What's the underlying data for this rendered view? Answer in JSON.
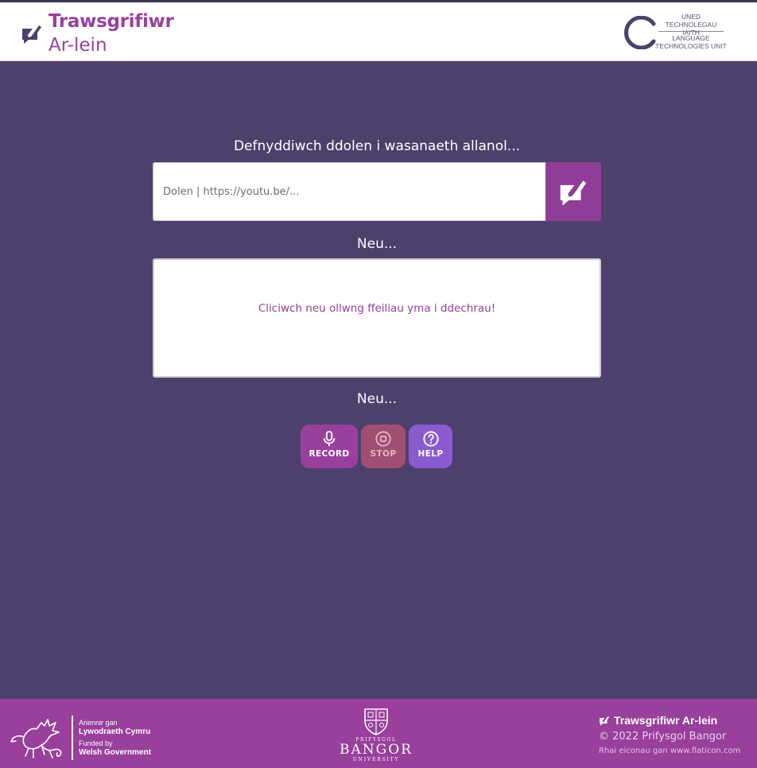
{
  "app": {
    "title": "Trawsgrifiwr",
    "subtitle": "Ar-lein"
  },
  "partner_logo": {
    "name": "ltu-logo",
    "line1": "UNED TECHNOLEGAU",
    "line2": "IAITH",
    "line3": "LANGUAGE",
    "line4": "TECHNOLOGIES UNIT"
  },
  "link_section": {
    "heading": "Defnyddiwch ddolen i wasanaeth allanol...",
    "placeholder": "Dolen | https://youtu.be/...",
    "value": "",
    "submit_icon": "edit-message-icon"
  },
  "or_text_1": "Neu...",
  "dropzone": {
    "text": "Cliciwch neu ollwng ffeiliau yma i ddechrau!"
  },
  "or_text_2": "Neu...",
  "buttons": {
    "record": {
      "label": "RECORD",
      "icon": "microphone-icon"
    },
    "stop": {
      "label": "STOP",
      "icon": "stop-circle-icon"
    },
    "help": {
      "label": "HELP",
      "icon": "question-circle-icon"
    }
  },
  "footer": {
    "funder_line1": "Ariennir gan",
    "funder_line2": "Lywodraeth Cymru",
    "funder_line3": "Funded by",
    "funder_line4": "Welsh Government",
    "university_prefix": "PRIFYSGOL",
    "university_name": "BANGOR",
    "university_suffix": "UNIVERSITY",
    "app_name": "Trawsgrifiwr Ar-lein",
    "copyright": "© 2022 Prifysgol Bangor",
    "icon_credit": "Rhai eiconau gan www.flaticon.com"
  },
  "colors": {
    "background": "#4d406c",
    "accent": "#993f9c",
    "stop": "#a14e72",
    "help": "#8a5ad0"
  }
}
